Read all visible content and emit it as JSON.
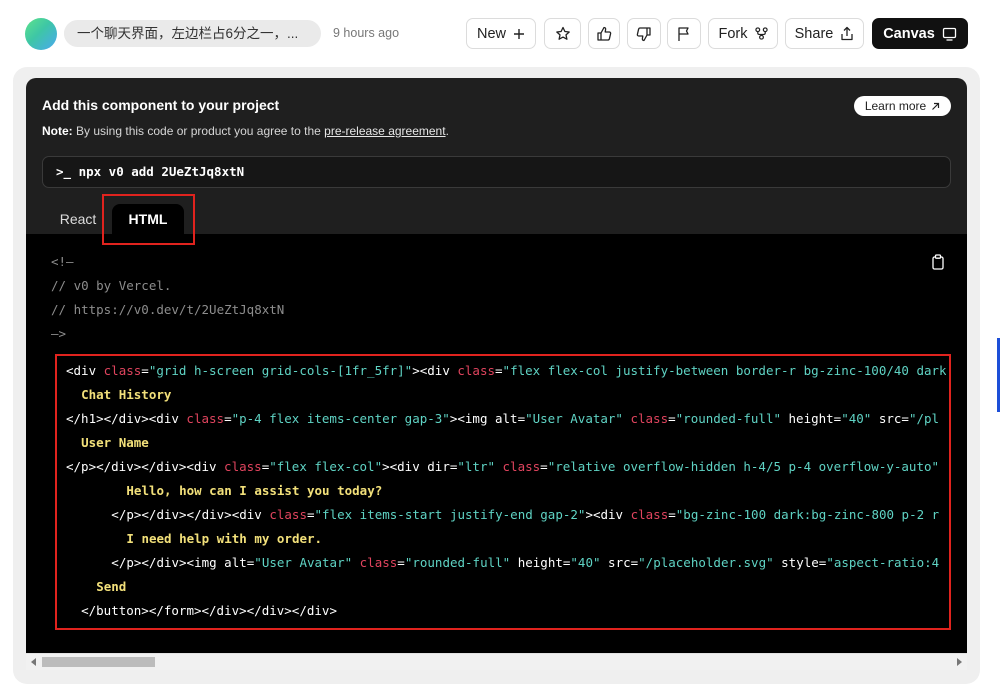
{
  "header": {
    "chat_title": "一个聊天界面，左边栏占6分之一，...",
    "timestamp": "9 hours ago",
    "buttons": {
      "new": "New",
      "fork": "Fork",
      "share": "Share",
      "canvas": "Canvas"
    }
  },
  "panel": {
    "title": "Add this component to your project",
    "note_bold": "Note:",
    "note_text": " By using this code or product you agree to the ",
    "note_link": "pre-release agreement",
    "note_end": ".",
    "learn_more": "Learn more",
    "command": ">_ npx v0 add 2UeZtJq8xtN",
    "tabs": {
      "react": "React",
      "html": "HTML"
    },
    "selected_tab": "HTML"
  },
  "code": {
    "comments": [
      "<!—",
      "// v0 by Vercel.",
      "// https://v0.dev/t/2UeZtJq8xtN",
      "—>"
    ],
    "lines": [
      {
        "indent": 0,
        "parts": [
          [
            "tag",
            "<div "
          ],
          [
            "attr",
            "class"
          ],
          [
            "plain",
            "="
          ],
          [
            "str",
            "\"grid h-screen grid-cols-[1fr_5fr]\""
          ],
          [
            "tag",
            "><div "
          ],
          [
            "attr",
            "class"
          ],
          [
            "plain",
            "="
          ],
          [
            "str",
            "\"flex flex-col justify-between border-r bg-zinc-100/40 dark"
          ]
        ]
      },
      {
        "indent": 2,
        "parts": [
          [
            "txt",
            "Chat History"
          ]
        ]
      },
      {
        "indent": 0,
        "parts": [
          [
            "tag",
            "</h1></div><div "
          ],
          [
            "attr",
            "class"
          ],
          [
            "plain",
            "="
          ],
          [
            "str",
            "\"p-4 flex items-center gap-3\""
          ],
          [
            "tag",
            "><img alt="
          ],
          [
            "str",
            "\"User Avatar\" "
          ],
          [
            "attr",
            "class"
          ],
          [
            "plain",
            "="
          ],
          [
            "str",
            "\"rounded-full\" "
          ],
          [
            "tag",
            "height="
          ],
          [
            "str",
            "\"40\" "
          ],
          [
            "tag",
            "src="
          ],
          [
            "str",
            "\"/pl"
          ]
        ]
      },
      {
        "indent": 2,
        "parts": [
          [
            "txt",
            "User Name"
          ]
        ]
      },
      {
        "indent": 0,
        "parts": [
          [
            "tag",
            "</p></div></div><div "
          ],
          [
            "attr",
            "class"
          ],
          [
            "plain",
            "="
          ],
          [
            "str",
            "\"flex flex-col\""
          ],
          [
            "tag",
            "><div dir="
          ],
          [
            "str",
            "\"ltr\" "
          ],
          [
            "attr",
            "class"
          ],
          [
            "plain",
            "="
          ],
          [
            "str",
            "\"relative overflow-hidden h-4/5 p-4 overflow-y-auto\""
          ]
        ]
      },
      {
        "indent": 8,
        "parts": [
          [
            "txt",
            "Hello, how can I assist you today?"
          ]
        ]
      },
      {
        "indent": 6,
        "parts": [
          [
            "tag",
            "</p></div></div><div "
          ],
          [
            "attr",
            "class"
          ],
          [
            "plain",
            "="
          ],
          [
            "str",
            "\"flex items-start justify-end gap-2\""
          ],
          [
            "tag",
            "><div "
          ],
          [
            "attr",
            "class"
          ],
          [
            "plain",
            "="
          ],
          [
            "str",
            "\"bg-zinc-100 dark:bg-zinc-800 p-2 r"
          ]
        ]
      },
      {
        "indent": 8,
        "parts": [
          [
            "txt",
            "I need help with my order."
          ]
        ]
      },
      {
        "indent": 6,
        "parts": [
          [
            "tag",
            "</p></div><img alt="
          ],
          [
            "str",
            "\"User Avatar\" "
          ],
          [
            "attr",
            "class"
          ],
          [
            "plain",
            "="
          ],
          [
            "str",
            "\"rounded-full\" "
          ],
          [
            "tag",
            "height="
          ],
          [
            "str",
            "\"40\" "
          ],
          [
            "tag",
            "src="
          ],
          [
            "str",
            "\"/placeholder.svg\" "
          ],
          [
            "tag",
            "style="
          ],
          [
            "str",
            "\"aspect-ratio:4"
          ]
        ]
      },
      {
        "indent": 4,
        "parts": [
          [
            "txt",
            "Send"
          ]
        ]
      },
      {
        "indent": 2,
        "parts": [
          [
            "tag",
            "</button></form></div></div></div>"
          ]
        ]
      }
    ]
  },
  "colors": {
    "highlight": "#e0231e",
    "code_tag": "#ffffff",
    "code_attr": "#e0445e",
    "code_string": "#5fd3c4",
    "code_text": "#f2e07a",
    "panel_bg": "#1f1f1f",
    "code_bg": "#000000"
  },
  "icons": {
    "new": "plus-icon",
    "star": "star-icon",
    "like": "thumbs-up-icon",
    "dislike": "thumbs-down-icon",
    "report": "flag-icon",
    "fork": "fork-icon",
    "share": "share-icon",
    "canvas": "canvas-icon",
    "learn_more": "arrow-up-right-icon",
    "copy": "clipboard-icon"
  }
}
